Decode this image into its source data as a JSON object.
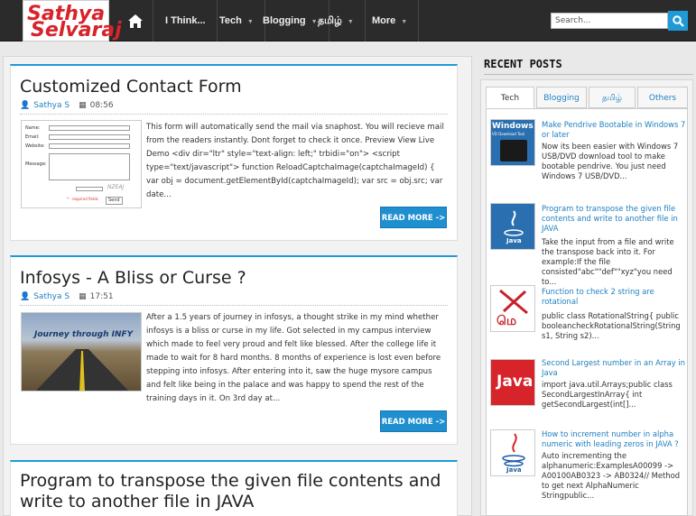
{
  "header": {
    "logo_part1": "Sathya",
    "logo_part2": "Selvaraj",
    "nav": [
      {
        "label": "I Think..."
      },
      {
        "label": "Tech"
      },
      {
        "label": "Blogging"
      },
      {
        "label": "தமிழ்"
      },
      {
        "label": "More"
      }
    ],
    "search_placeholder": "Search..."
  },
  "posts": [
    {
      "title": "Customized Contact Form",
      "author": "Sathya S",
      "time": "08:56",
      "excerpt": "This form will automatically send the mail via snaphost. You will recieve mail from the readers instantly. Dont forget to check it once. Preview View Live Demo <div dir=\"ltr\" style=\"text-align: left;\" trbidi=\"on\"> <script type=\"text/javascript\"> function ReloadCaptchaImage(captchaImageId) {     var obj = document.getElementById(captchaImageId);     var src = obj.src;     var date...",
      "read_more": "READ MORE ->",
      "form_thumb": {
        "name": "Name:",
        "email": "Email:",
        "website": "Website:",
        "message": "Message:",
        "captcha": "NZEAJ",
        "required": "* - required fields",
        "send": "Send"
      }
    },
    {
      "title": "Infosys - A Bliss or Curse ?",
      "author": "Sathya S",
      "time": "17:51",
      "thumb_caption": "Journey through INFY",
      "excerpt": "After a 1.5 years of journey in infosys, a thought strike in my mind whether infosys is a bliss or curse in my life. Got selected in my campus interview which made to feel very proud and felt like blessed. After the college life it made to wait for 8 hard months. 8 months of experience is lost even before stepping into infosys. After entering into it, saw the huge mysore campus and felt like being in the palace and was happy to spend the rest of the training days in it. On 3rd day at...",
      "read_more": "READ MORE ->"
    },
    {
      "title": "Program to transpose the given file contents and write to another file in JAVA"
    }
  ],
  "sidebar": {
    "heading": "RECENT POSTS",
    "tabs": [
      "Tech",
      "Blogging",
      "தமிழ்",
      "Others"
    ],
    "active_tab": "Tech",
    "items": [
      {
        "title": "Make Pendrive Bootable in Windows 7 or later",
        "text": "Now its been easier with Windows 7 USB/DVD download tool to make bootable pendrive. You just need Windows 7 USB/DVD...",
        "thumb": "Windows",
        "thumb_sub": "VD Download Tool"
      },
      {
        "title": "Program to transpose the given file contents and write to another file in JAVA",
        "text": "Take the input from a file and write the transpose back into it. For example:If the file consisted\"abc\"\"def\"\"xyz\"you need to...",
        "thumb": "Java"
      },
      {
        "title": "Function to check 2 string are rotational",
        "text": "public class RotationalString{   public booleancheckRotationalString(String s1, String s2)...",
        "thumb": "மெ"
      },
      {
        "title": "Second Largest number in an Array in Java",
        "text": "import java.util.Arrays;public class SecondLargestInArray{   int getSecondLargest(int[]...",
        "thumb": "Java"
      },
      {
        "title": "How to increment number in alpha numeric with leading zeros in JAVA ?",
        "text": "Auto incrementing the alphanumeric:ExamplesA00099 -> A00100AB0323 -> AB0324// Method to get next AlphaNumeric Stringpublic...",
        "thumb": "Java"
      }
    ]
  }
}
